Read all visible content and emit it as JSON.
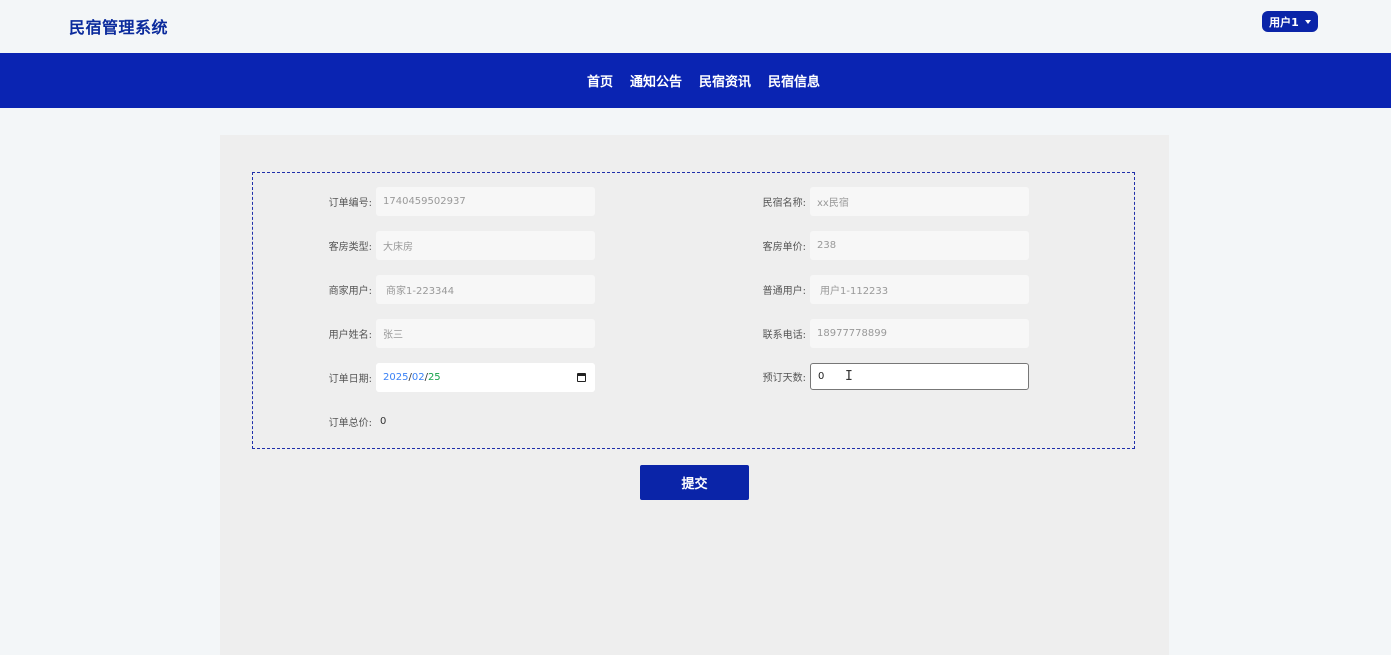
{
  "app": {
    "title": "民宿管理系统",
    "user_menu_label": "用户1"
  },
  "nav": {
    "items": [
      "首页",
      "通知公告",
      "民宿资讯",
      "民宿信息"
    ]
  },
  "form": {
    "order_no": {
      "label": "订单编号:",
      "value": "1740459502937"
    },
    "homestay_name": {
      "label": "民宿名称:",
      "value": "xx民宿"
    },
    "room_type": {
      "label": "客房类型:",
      "value": "大床房"
    },
    "room_price": {
      "label": "客房单价:",
      "value": "238"
    },
    "merchant_user": {
      "label": "商家用户:",
      "value": "商家1-223344"
    },
    "normal_user": {
      "label": "普通用户:",
      "value": "用户1-112233"
    },
    "user_name": {
      "label": "用户姓名:",
      "value": "张三"
    },
    "phone": {
      "label": "联系电话:",
      "value": "18977778899"
    },
    "order_date": {
      "label": "订单日期:",
      "year": "2025",
      "month": "02",
      "day": "25",
      "separator": "/"
    },
    "days": {
      "label": "预订天数:",
      "value": "0"
    },
    "total": {
      "label": "订单总价:",
      "value": "0"
    }
  },
  "submit_label": "提交",
  "colors": {
    "brand": "#0a24b2",
    "title": "#0a2a9c",
    "panel_bg": "#eeeeee",
    "page_bg": "#f3f6f8"
  }
}
